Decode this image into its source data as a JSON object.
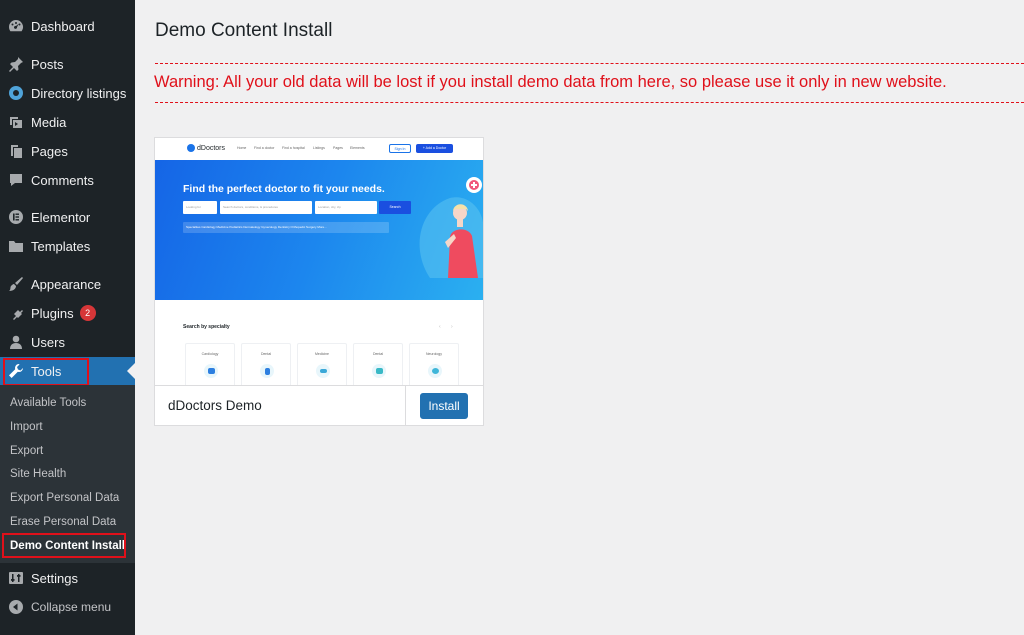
{
  "sidebar": {
    "items": [
      {
        "label": "Dashboard",
        "icon": "dashboard-icon"
      },
      {
        "label": "Posts",
        "icon": "pushpin-icon"
      },
      {
        "label": "Directory listings",
        "icon": "directory-icon"
      },
      {
        "label": "Media",
        "icon": "media-icon"
      },
      {
        "label": "Pages",
        "icon": "pages-icon"
      },
      {
        "label": "Comments",
        "icon": "comment-icon"
      },
      {
        "label": "Elementor",
        "icon": "elementor-icon"
      },
      {
        "label": "Templates",
        "icon": "folder-icon"
      },
      {
        "label": "Appearance",
        "icon": "brush-icon"
      },
      {
        "label": "Plugins",
        "icon": "plug-icon",
        "badge": "2"
      },
      {
        "label": "Users",
        "icon": "user-icon"
      },
      {
        "label": "Tools",
        "icon": "wrench-icon",
        "active": true
      },
      {
        "label": "Settings",
        "icon": "settings-icon"
      },
      {
        "label": "Collapse menu",
        "icon": "collapse-icon"
      }
    ],
    "tools_submenu": [
      "Available Tools",
      "Import",
      "Export",
      "Site Health",
      "Export Personal Data",
      "Erase Personal Data",
      "Demo Content Install"
    ],
    "current_submenu": "Demo Content Install",
    "active_color": "#2271b1",
    "highlight_color": "#e0101a"
  },
  "main": {
    "title": "Demo Content Install",
    "warning": "Warning: All your old data will be lost if you install demo data from here, so please use it only in new website.",
    "warning_color": "#e0101a",
    "demo": {
      "name": "dDoctors Demo",
      "install_label": "Install",
      "preview": {
        "logo": "dDoctors",
        "nav_links": [
          "Home",
          "Find a doctor",
          "Find a hospital",
          "Listings",
          "Pages",
          "Elements"
        ],
        "signin": "Sign In",
        "add_button": "+ Add a Doctor",
        "headline": "Find the perfect doctor to fit your needs.",
        "input_placeholders": [
          "Looking for",
          "Search doctors, conditions, & procedures",
          "Location, city, zip"
        ],
        "search_label": "Search",
        "tags": "Specialties   Cardiology   Medicine   Pediatrics   Dermatology   Gynecology   Dentistry   Orthopedic Surgery   More...",
        "section_title": "Search by specialty",
        "specialties": [
          "Cardiology",
          "Dental",
          "Medicine",
          "Dental",
          "Neurology"
        ]
      }
    }
  }
}
